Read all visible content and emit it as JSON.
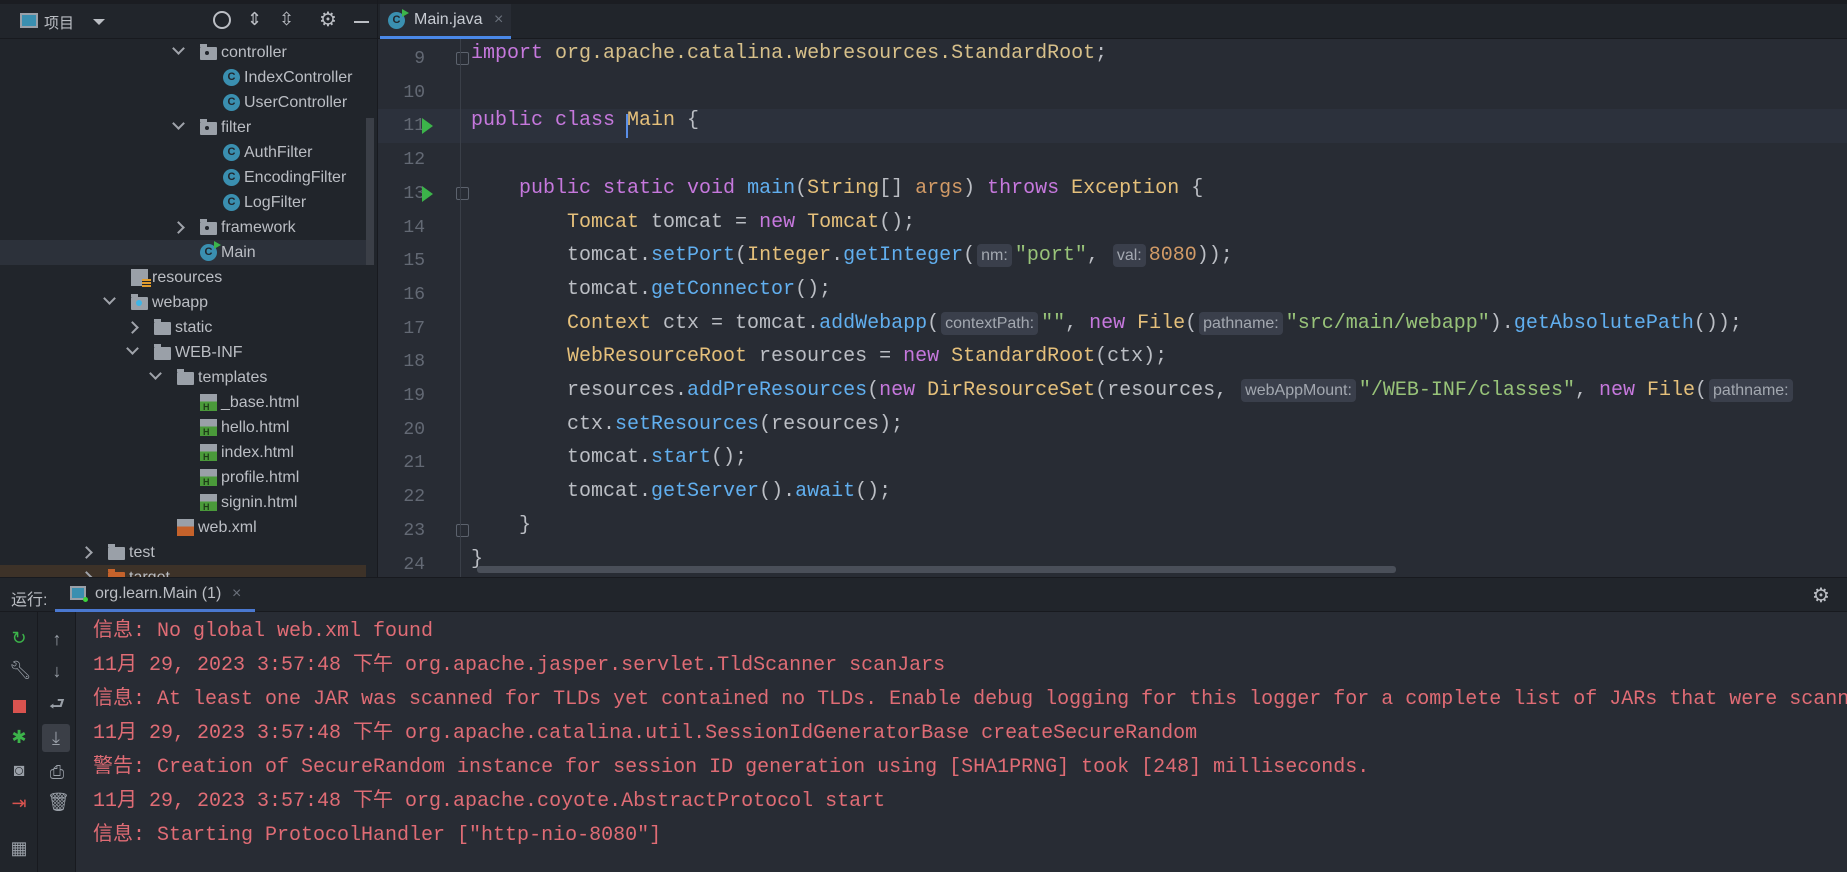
{
  "sidebar": {
    "title": "项目",
    "tree": [
      {
        "label": "controller",
        "level": 4,
        "icon": "folder-package-icon",
        "kind": "pkg",
        "chevron": "open"
      },
      {
        "label": "IndexController",
        "level": 5,
        "icon": "java-class-icon",
        "kind": "cls"
      },
      {
        "label": "UserController",
        "level": 5,
        "icon": "java-class-icon",
        "kind": "cls"
      },
      {
        "label": "filter",
        "level": 4,
        "icon": "folder-package-icon",
        "kind": "pkg",
        "chevron": "open"
      },
      {
        "label": "AuthFilter",
        "level": 5,
        "icon": "java-class-icon",
        "kind": "cls"
      },
      {
        "label": "EncodingFilter",
        "level": 5,
        "icon": "java-class-icon",
        "kind": "cls"
      },
      {
        "label": "LogFilter",
        "level": 5,
        "icon": "java-class-icon",
        "kind": "cls"
      },
      {
        "label": "framework",
        "level": 4,
        "icon": "folder-package-icon",
        "kind": "pkg",
        "chevron": "closed"
      },
      {
        "label": "Main",
        "level": 4,
        "icon": "java-main-class-icon",
        "kind": "main",
        "selected": true
      },
      {
        "label": "resources",
        "level": 1,
        "icon": "resources-folder-icon",
        "kind": "res"
      },
      {
        "label": "webapp",
        "level": 1,
        "icon": "web-folder-icon",
        "kind": "web",
        "chevron": "open"
      },
      {
        "label": "static",
        "level": 2,
        "icon": "folder-icon",
        "kind": "folder",
        "chevron": "closed"
      },
      {
        "label": "WEB-INF",
        "level": 2,
        "icon": "folder-icon",
        "kind": "folder",
        "chevron": "open"
      },
      {
        "label": "templates",
        "level": 3,
        "icon": "folder-icon",
        "kind": "folder",
        "chevron": "open"
      },
      {
        "label": "_base.html",
        "level": 4,
        "icon": "html-file-icon",
        "kind": "html"
      },
      {
        "label": "hello.html",
        "level": 4,
        "icon": "html-file-icon",
        "kind": "html"
      },
      {
        "label": "index.html",
        "level": 4,
        "icon": "html-file-icon",
        "kind": "html"
      },
      {
        "label": "profile.html",
        "level": 4,
        "icon": "html-file-icon",
        "kind": "html"
      },
      {
        "label": "signin.html",
        "level": 4,
        "icon": "html-file-icon",
        "kind": "html"
      },
      {
        "label": "web.xml",
        "level": 3,
        "icon": "web-xml-file-icon",
        "kind": "xml"
      },
      {
        "label": "test",
        "level": 0,
        "icon": "folder-icon",
        "kind": "folder",
        "chevron": "closed"
      },
      {
        "label": "target",
        "level": 0,
        "icon": "excluded-folder-icon",
        "kind": "orange",
        "chevron": "closed",
        "excluded": true
      }
    ]
  },
  "editor": {
    "tab": {
      "label": "Main.java",
      "icon": "java-main-class-icon"
    },
    "current_line": 11,
    "lines": [
      {
        "n": "9",
        "fold": true,
        "tokens": [
          [
            "import",
            "k"
          ],
          [
            " ",
            ""
          ],
          [
            "org.apache.catalina.webresources.StandardRoot",
            "pk"
          ],
          [
            ";",
            ""
          ]
        ]
      },
      {
        "n": "10",
        "tokens": []
      },
      {
        "n": "11",
        "run": true,
        "tokens": [
          [
            "public class ",
            "k"
          ],
          [
            "Main",
            "t"
          ],
          [
            " {",
            ""
          ]
        ]
      },
      {
        "n": "12",
        "tokens": []
      },
      {
        "n": "13",
        "run": true,
        "fold": true,
        "tokens": [
          [
            "    ",
            ""
          ],
          [
            "public static void ",
            "k"
          ],
          [
            "main",
            "f"
          ],
          [
            "(",
            ""
          ],
          [
            "String",
            "t"
          ],
          [
            "[] ",
            ""
          ],
          [
            "args",
            "p"
          ],
          [
            ") ",
            ""
          ],
          [
            "throws ",
            "k"
          ],
          [
            "Exception",
            "t"
          ],
          [
            " {",
            ""
          ]
        ]
      },
      {
        "n": "14",
        "tokens": [
          [
            "        ",
            ""
          ],
          [
            "Tomcat",
            "t"
          ],
          [
            " tomcat = ",
            ""
          ],
          [
            "new ",
            "k"
          ],
          [
            "Tomcat",
            "t"
          ],
          [
            "();",
            ""
          ]
        ]
      },
      {
        "n": "15",
        "tokens": [
          [
            "        tomcat.",
            ""
          ],
          [
            "setPort",
            "f"
          ],
          [
            "(",
            ""
          ],
          [
            "Integer",
            "t"
          ],
          [
            ".",
            ""
          ],
          [
            "getInteger",
            "f"
          ],
          [
            "(",
            ""
          ],
          [
            "nm:",
            "h"
          ],
          [
            "\"port\"",
            "s"
          ],
          [
            ", ",
            ""
          ],
          [
            "val:",
            "h"
          ],
          [
            "8080",
            "n"
          ],
          [
            "));",
            ""
          ]
        ]
      },
      {
        "n": "16",
        "tokens": [
          [
            "        tomcat.",
            ""
          ],
          [
            "getConnector",
            "f"
          ],
          [
            "();",
            ""
          ]
        ]
      },
      {
        "n": "17",
        "tokens": [
          [
            "        ",
            ""
          ],
          [
            "Context",
            "t"
          ],
          [
            " ctx = tomcat.",
            ""
          ],
          [
            "addWebapp",
            "f"
          ],
          [
            "(",
            ""
          ],
          [
            "contextPath:",
            "h"
          ],
          [
            "\"\"",
            "s"
          ],
          [
            ", ",
            ""
          ],
          [
            "new ",
            "k"
          ],
          [
            "File",
            "t"
          ],
          [
            "(",
            ""
          ],
          [
            "pathname:",
            "h"
          ],
          [
            "\"src/main/webapp\"",
            "s"
          ],
          [
            ").",
            ""
          ],
          [
            "getAbsolutePath",
            "f"
          ],
          [
            "());",
            ""
          ]
        ]
      },
      {
        "n": "18",
        "tokens": [
          [
            "        ",
            ""
          ],
          [
            "WebResourceRoot",
            "t"
          ],
          [
            " resources = ",
            ""
          ],
          [
            "new ",
            "k"
          ],
          [
            "StandardRoot",
            "t"
          ],
          [
            "(ctx);",
            ""
          ]
        ]
      },
      {
        "n": "19",
        "tokens": [
          [
            "        resources.",
            ""
          ],
          [
            "addPreResources",
            "f"
          ],
          [
            "(",
            ""
          ],
          [
            "new ",
            "k"
          ],
          [
            "DirResourceSet",
            "t"
          ],
          [
            "(resources, ",
            ""
          ],
          [
            "webAppMount:",
            "h"
          ],
          [
            "\"/WEB-INF/classes\"",
            "s"
          ],
          [
            ", ",
            ""
          ],
          [
            "new ",
            "k"
          ],
          [
            "File",
            "t"
          ],
          [
            "(",
            ""
          ],
          [
            "pathname:",
            "h"
          ]
        ]
      },
      {
        "n": "20",
        "tokens": [
          [
            "        ctx.",
            ""
          ],
          [
            "setResources",
            "f"
          ],
          [
            "(resources);",
            ""
          ]
        ]
      },
      {
        "n": "21",
        "tokens": [
          [
            "        tomcat.",
            ""
          ],
          [
            "start",
            "f"
          ],
          [
            "();",
            ""
          ]
        ]
      },
      {
        "n": "22",
        "tokens": [
          [
            "        tomcat.",
            ""
          ],
          [
            "getServer",
            "f"
          ],
          [
            "().",
            ""
          ],
          [
            "await",
            "f"
          ],
          [
            "();",
            ""
          ]
        ]
      },
      {
        "n": "23",
        "fold": true,
        "tokens": [
          [
            "    }",
            ""
          ]
        ]
      },
      {
        "n": "24",
        "tokens": [
          [
            "}",
            ""
          ]
        ]
      }
    ]
  },
  "run_panel": {
    "label": "运行:",
    "tab": "org.learn.Main (1)",
    "console": [
      "信息: No global web.xml found",
      "11月 29, 2023 3:57:48 下午 org.apache.jasper.servlet.TldScanner scanJars",
      "信息: At least one JAR was scanned for TLDs yet contained no TLDs. Enable debug logging for this logger for a complete list of JARs that were scann",
      "11月 29, 2023 3:57:48 下午 org.apache.catalina.util.SessionIdGeneratorBase createSecureRandom",
      "警告: Creation of SecureRandom instance for session ID generation using [SHA1PRNG] took [248] milliseconds.",
      "11月 29, 2023 3:57:48 下午 org.apache.coyote.AbstractProtocol start",
      "信息: Starting ProtocolHandler [\"http-nio-8080\"]"
    ]
  },
  "colors": {
    "console_text": "#e06c75",
    "accent": "#4a88e8",
    "run_green": "#3cb44a"
  }
}
